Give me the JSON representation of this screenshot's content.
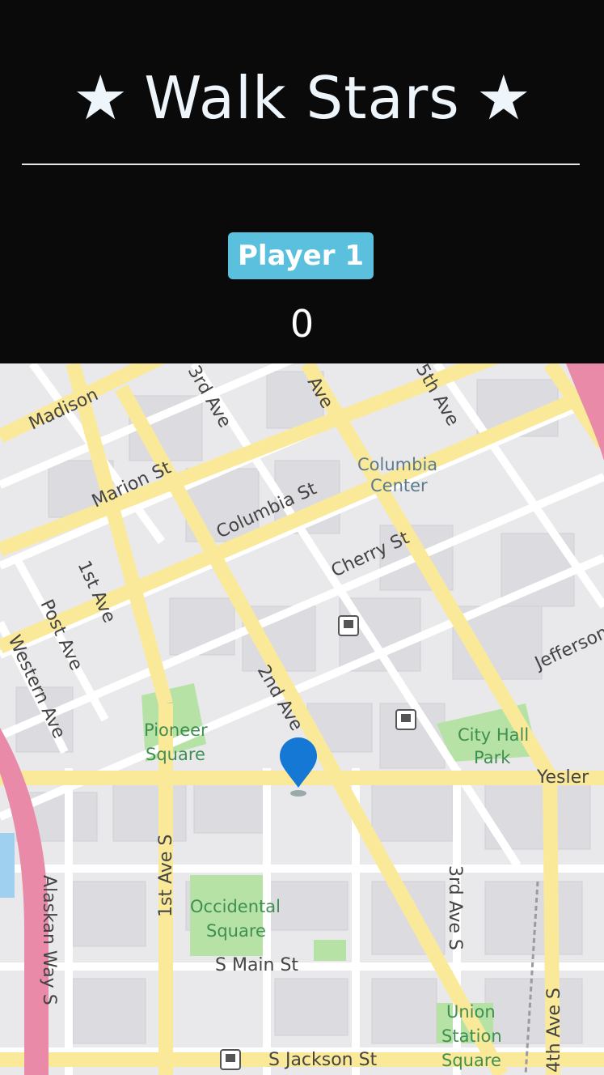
{
  "app": {
    "title": "Walk Stars",
    "star_left": "★",
    "star_right": "★"
  },
  "player": {
    "label": "Player 1",
    "score": "0"
  },
  "map": {
    "streets": {
      "madison": "Madison",
      "marion_st": "Marion St",
      "third_ave_top": "3rd Ave",
      "ave_top": "Ave",
      "fifth_ave_top": "5th Ave",
      "columbia_st": "Columbia St",
      "cherry_st": "Cherry St",
      "first_ave": "1st Ave",
      "post_ave": "Post Ave",
      "western_ave": "Western Ave",
      "second_ave": "2nd Ave",
      "jefferson": "Jefferson",
      "yesler": "Yesler",
      "first_ave_s": "1st Ave S",
      "third_ave_s": "3rd Ave S",
      "fourth_ave_s": "4th Ave S",
      "s_main_st": "S Main St",
      "s_jackson_st": "S Jackson St",
      "alaskan_way": "Alaskan Way S"
    },
    "places": {
      "columbia_center_1": "Columbia",
      "columbia_center_2": "Center",
      "pioneer_1": "Pioneer",
      "pioneer_2": "Square",
      "city_hall_1": "City Hall",
      "city_hall_2": "Park",
      "occidental_1": "Occidental",
      "occidental_2": "Square",
      "union_1": "Union",
      "union_2": "Station",
      "union_3": "Square"
    },
    "colors": {
      "road_major": "#fbe99a",
      "road_minor": "#ffffff",
      "park": "#b6e3a5",
      "highway": "#e98aa8",
      "water": "#9fd0ef",
      "block": "#dcdce0",
      "marker": "#1478d4"
    },
    "icons": [
      "transit-station-icon",
      "transit-station-icon",
      "transit-station-icon",
      "location-marker-icon"
    ]
  }
}
